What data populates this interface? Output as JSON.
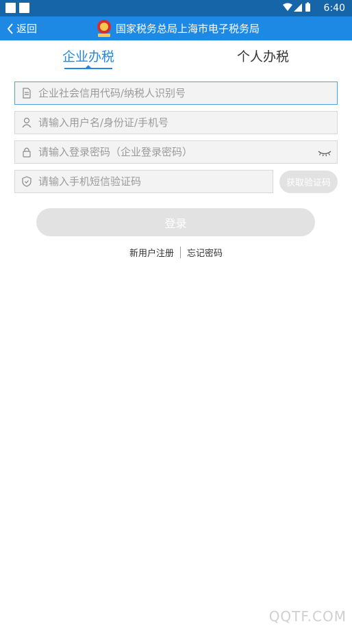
{
  "status_bar": {
    "time": "6:40"
  },
  "header": {
    "back_label": "返回",
    "title": "国家税务总局上海市电子税务局"
  },
  "tabs": [
    {
      "label": "企业办税",
      "active": true
    },
    {
      "label": "个人办税",
      "active": false
    }
  ],
  "form": {
    "credit_code_placeholder": "企业社会信用代码/纳税人识别号",
    "username_placeholder": "请输入用户名/身份证/手机号",
    "password_placeholder": "请输入登录密码（企业登录密码）",
    "sms_placeholder": "请输入手机短信验证码",
    "sms_button_label": "获取验证码",
    "login_button_label": "登录"
  },
  "links": {
    "register": "新用户注册",
    "forgot": "忘记密码"
  },
  "watermark": "QQTF.COM",
  "colors": {
    "header_bg": "#1e88e5",
    "status_bg": "#1565a8",
    "accent": "#1e88e5",
    "disabled_button": "#e2e2e2"
  }
}
